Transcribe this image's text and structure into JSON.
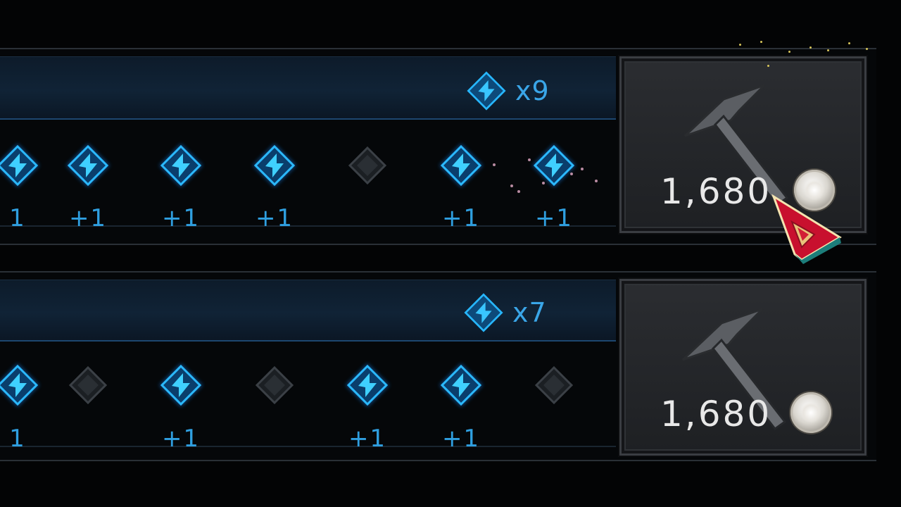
{
  "rows": [
    {
      "counter": "x9",
      "cost": "1,680",
      "slot_states": [
        "filled",
        "filled",
        "filled",
        "filled",
        "empty",
        "filled",
        "filled"
      ],
      "plus_labels": [
        "1",
        "+1",
        "+1",
        "+1",
        "",
        "+1",
        "+1"
      ]
    },
    {
      "counter": "x7",
      "cost": "1,680",
      "slot_states": [
        "filled",
        "empty",
        "filled",
        "empty",
        "filled",
        "filled",
        "empty"
      ],
      "plus_labels": [
        "1",
        "",
        "+1",
        "",
        "+1",
        "+1",
        ""
      ]
    }
  ],
  "icons": {
    "stone": "blue-stone-icon",
    "empty_slot": "empty-slot-icon",
    "craft": "hammer-icon",
    "currency": "silver-coin-icon",
    "pointer": "red-pointer-icon"
  },
  "colors": {
    "accent_blue": "#3aa6e8",
    "stone_blue": "#27b7ff",
    "header_bg": "#0f2134",
    "button_bg": "#26282c",
    "text_white": "#e8e8e8",
    "pointer_red": "#c8102e"
  }
}
